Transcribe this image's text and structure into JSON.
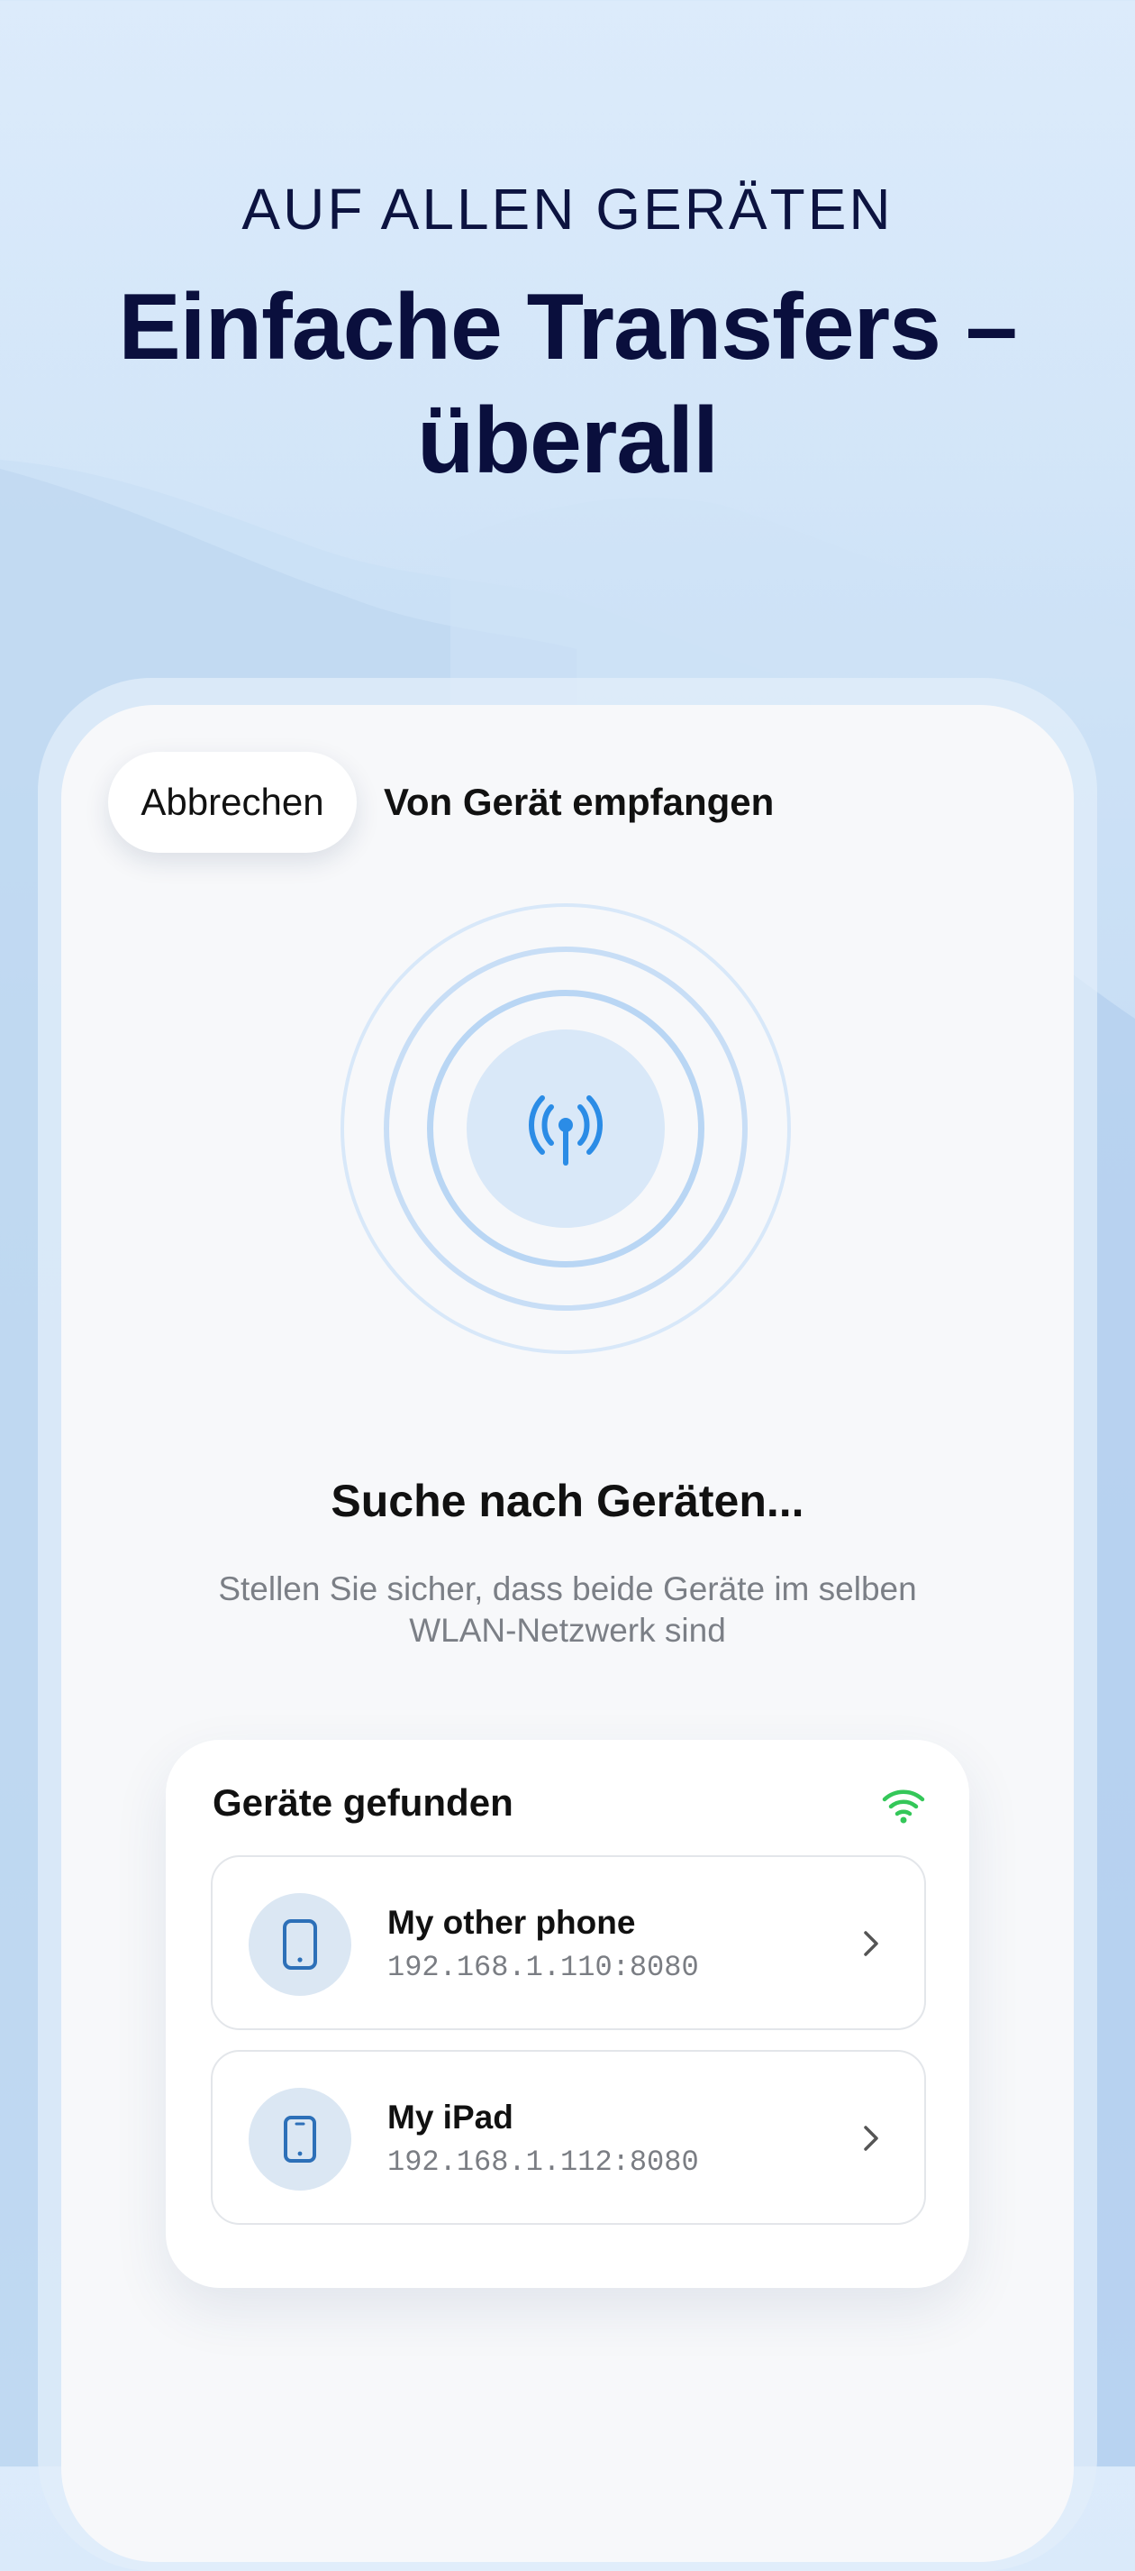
{
  "hero": {
    "kicker": "AUF ALLEN GERÄTEN",
    "headline_line1": "Einfache Transfers –",
    "headline_line2": "überall"
  },
  "screen": {
    "cancel_label": "Abbrechen",
    "title": "Von Gerät empfangen",
    "status_title": "Suche nach Geräten...",
    "status_subtitle": "Stellen Sie sicher, dass beide Geräte im selben WLAN-Netzwerk sind"
  },
  "devices_card": {
    "title": "Geräte gefunden",
    "devices": [
      {
        "name": "My other phone",
        "address": "192.168.1.110:8080",
        "icon": "phone-icon"
      },
      {
        "name": "My iPad",
        "address": "192.168.1.112:8080",
        "icon": "tablet-icon"
      }
    ]
  },
  "colors": {
    "accent": "#2b8ce6",
    "wifi_green": "#34c759",
    "headline": "#0a0f3d"
  }
}
